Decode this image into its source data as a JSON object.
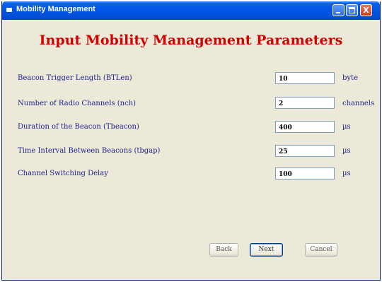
{
  "window": {
    "title": "Mobility Management",
    "minimize_glyph": "",
    "maximize_glyph": "",
    "close_glyph": "X"
  },
  "heading": "Input Mobility Management Parameters",
  "fields": [
    {
      "label": "Beacon Trigger Length (BTLen)",
      "value": "10",
      "unit": "byte"
    },
    {
      "label": "Number of Radio Channels (nch)",
      "value": "2",
      "unit": "channels"
    },
    {
      "label": "Duration of the Beacon (Tbeacon)",
      "value": "400",
      "unit": "µs"
    },
    {
      "label": "Time Interval Between Beacons (tbgap)",
      "value": "25",
      "unit": "µs"
    },
    {
      "label": "Channel Switching Delay",
      "value": "100",
      "unit": "µs"
    }
  ],
  "buttons": {
    "back": "Back",
    "next": "Next",
    "cancel": "Cancel"
  },
  "colors": {
    "heading": "#d40000",
    "label": "#1b1f8c",
    "titlebar": "#0058e6",
    "window_bg": "#ece9d8"
  }
}
